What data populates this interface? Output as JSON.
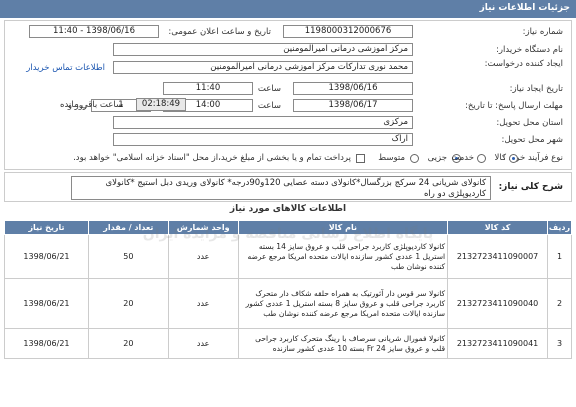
{
  "header": {
    "title": "جزئیات اطلاعات نیاز"
  },
  "form": {
    "need_number_label": "شماره نیاز:",
    "need_number": "1198000312000676",
    "announce_label": "تاریخ و ساعت اعلان عمومی:",
    "announce_value": "1398/06/16 - 11:40",
    "buyer_label": "نام دستگاه خریدار:",
    "buyer_value": "مرکز آموزشی درمانی امیرالمومنین",
    "requester_label": "ایجاد کننده درخواست:",
    "requester_value": "محمد نوری تدارکات مرکز آموزشی درمانی امیرالمومنین",
    "contact_link": "اطلاعات تماس خریدار",
    "created_label": "تاریخ ایجاد نیاز:",
    "created_date": "1398/06/16",
    "created_time_label": "ساعت",
    "created_time": "11:40",
    "deadline_label": "مهلت ارسال پاسخ: تا تاریخ:",
    "deadline_date": "1398/06/17",
    "deadline_time_label": "ساعت",
    "deadline_time": "14:00",
    "days_value": "1",
    "days_label": "روز و",
    "remaining_time": "02:18:49",
    "remaining_label": "ساعت باقی مانده",
    "province_label": "استان محل تحویل:",
    "province_value": "مرکزی",
    "city_label": "شهر محل تحویل:",
    "city_value": "اراک",
    "purchase_type_label": "نوع فرآیند خرید :",
    "option_partial": "جزیی",
    "option_medium": "متوسط",
    "payment_note": "پرداخت تمام و یا بخشی از مبلغ خرید،از محل \"اسناد خزانه اسلامی\" خواهد بود.",
    "goods_label": "کالا",
    "service_label": "خدمت"
  },
  "description": {
    "label": "شرح کلی نیاز:",
    "text": "کانولای شریانی 24 سرکج بزرگسال*کانولای دسته عصایی 120و90درجه* کانولای وریدی دبل استیج *کانولای کاردیوپلژی دو راه"
  },
  "items_section": {
    "title": "اطلاعات کالاهای مورد نیاز",
    "watermark": "پایگاه اطلاع رسانی مناقصه و مزایده ایران",
    "columns": [
      "ردیف",
      "کد کالا",
      "نام کالا",
      "واحد شمارش",
      "تعداد / مقدار",
      "تاریخ نیاز"
    ],
    "rows": [
      {
        "index": "1",
        "code": "2132723411090007",
        "name": "کانولا کاردیوپلژی کاربرد جراحی قلب و عروق سایز 14 بسته استریل 1 عددی کشور سازنده ایالات متحده امریکا مرجع عرضه کننده نوشان طب",
        "unit": "عدد",
        "qty": "50",
        "date": "1398/06/21"
      },
      {
        "index": "2",
        "code": "2132723411090040",
        "name": "کانولا سر قوس دار آئورتیک به همراه حلقه شکاف دار متحرک کاربرد جراحی قلب و عروق سایز 8 بسته استریل 1 عددی کشور سازنده ایالات متحده امریکا مرجع عرضه کننده نوشان طب",
        "unit": "عدد",
        "qty": "20",
        "date": "1398/06/21"
      },
      {
        "index": "3",
        "code": "2132723411090041",
        "name": "کانولا فمورال شریانی سرصاف با رینگ متحرک کاربرد جراحی قلب و عروق سایز 24 Fr بسته 10 عددی کشور سازنده",
        "unit": "عدد",
        "qty": "20",
        "date": "1398/06/21"
      }
    ]
  }
}
